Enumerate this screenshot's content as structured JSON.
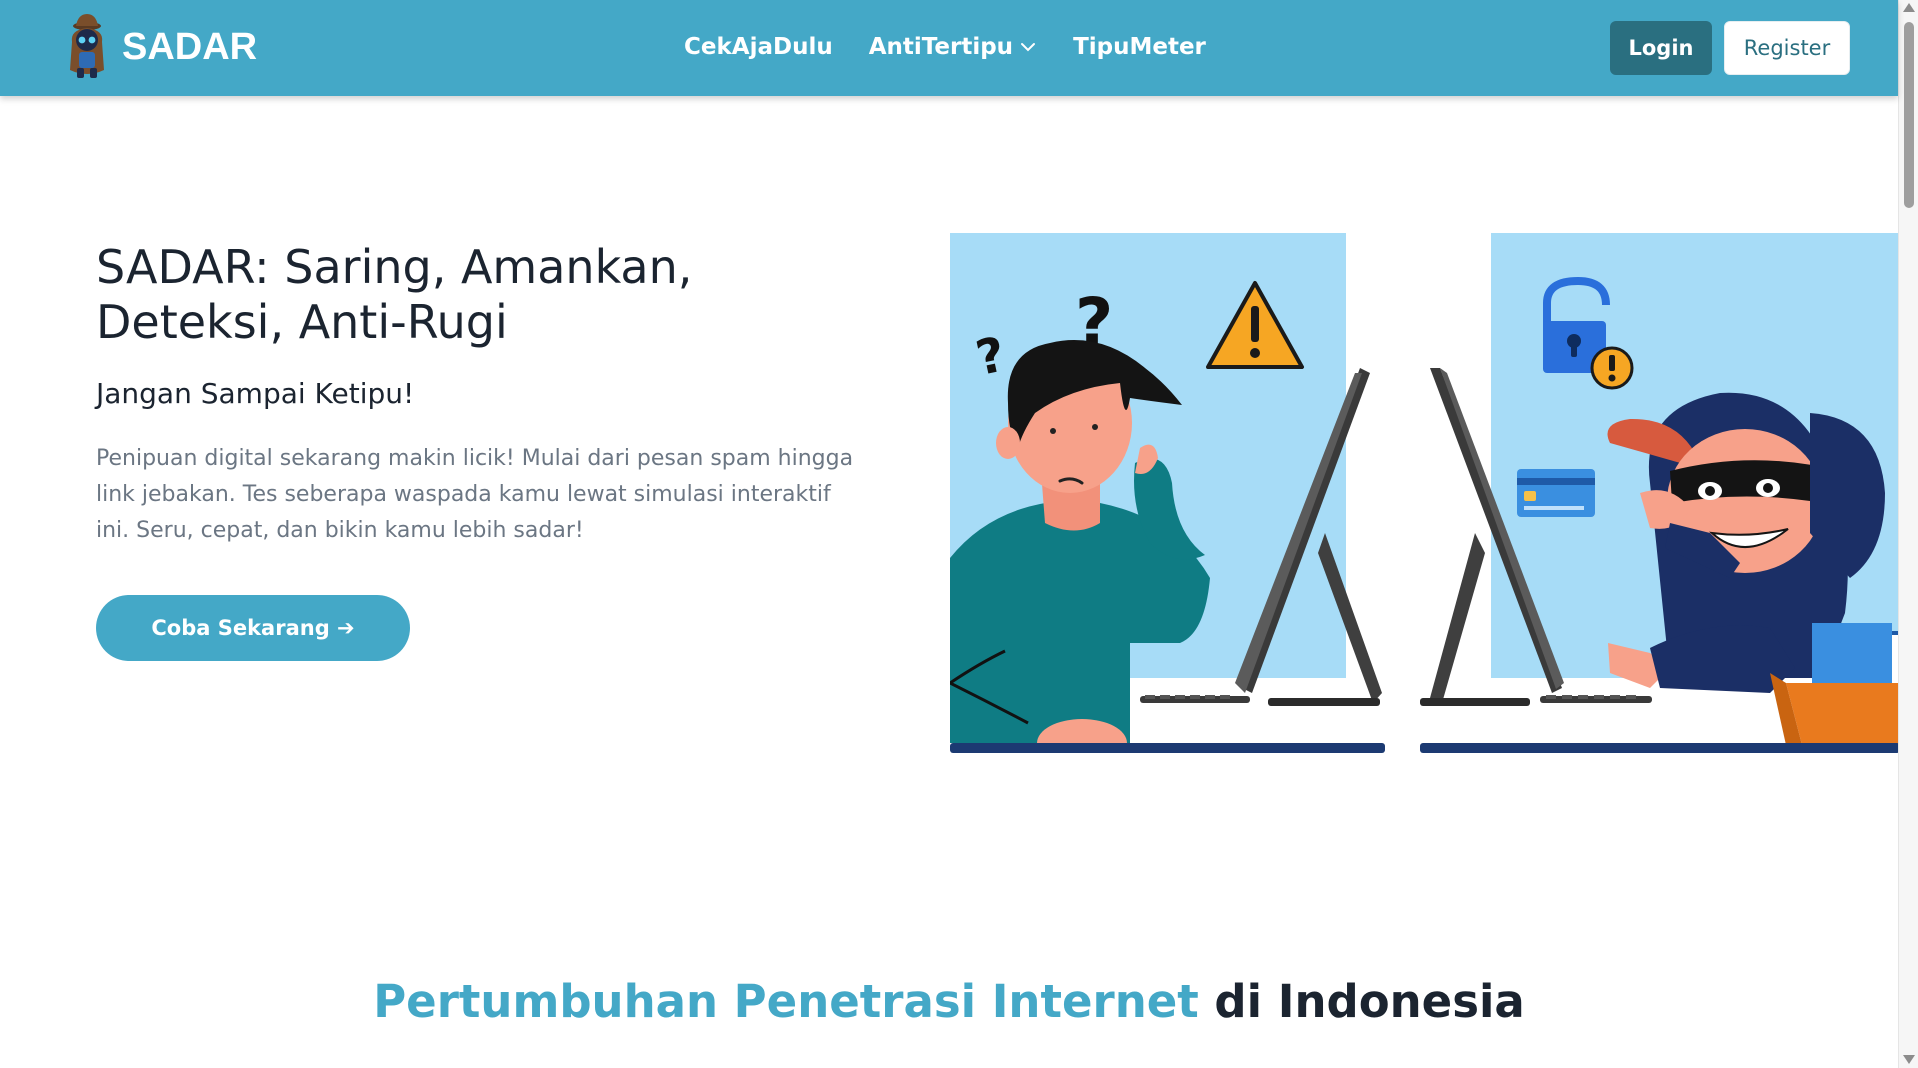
{
  "navbar": {
    "brand": "SADAR",
    "links": [
      {
        "label": "CekAjaDulu"
      },
      {
        "label": "AntiTertipu",
        "has_dropdown": true
      },
      {
        "label": "TipuMeter"
      }
    ],
    "login_label": "Login",
    "register_label": "Register",
    "bg_color": "#44a8c7"
  },
  "hero": {
    "title": "SADAR: Saring, Amankan, Deteksi, Anti-Rugi",
    "subtitle": "Jangan Sampai Ketipu!",
    "description": "Penipuan digital sekarang makin licik! Mulai dari pesan spam hingga link jebakan. Tes seberapa waspada kamu lewat simulasi interaktif ini. Seru, cepat, dan bikin kamu lebih sadar!",
    "cta_label": "Coba Sekarang ➔"
  },
  "section": {
    "title_accent": "Pertumbuhan Penetrasi Internet",
    "title_rest": " di Indonesia"
  },
  "icons": [
    "spy-logo-icon",
    "chevron-down-icon",
    "question-mark-icon",
    "warning-icon",
    "lock-icon",
    "credit-card-icon"
  ]
}
